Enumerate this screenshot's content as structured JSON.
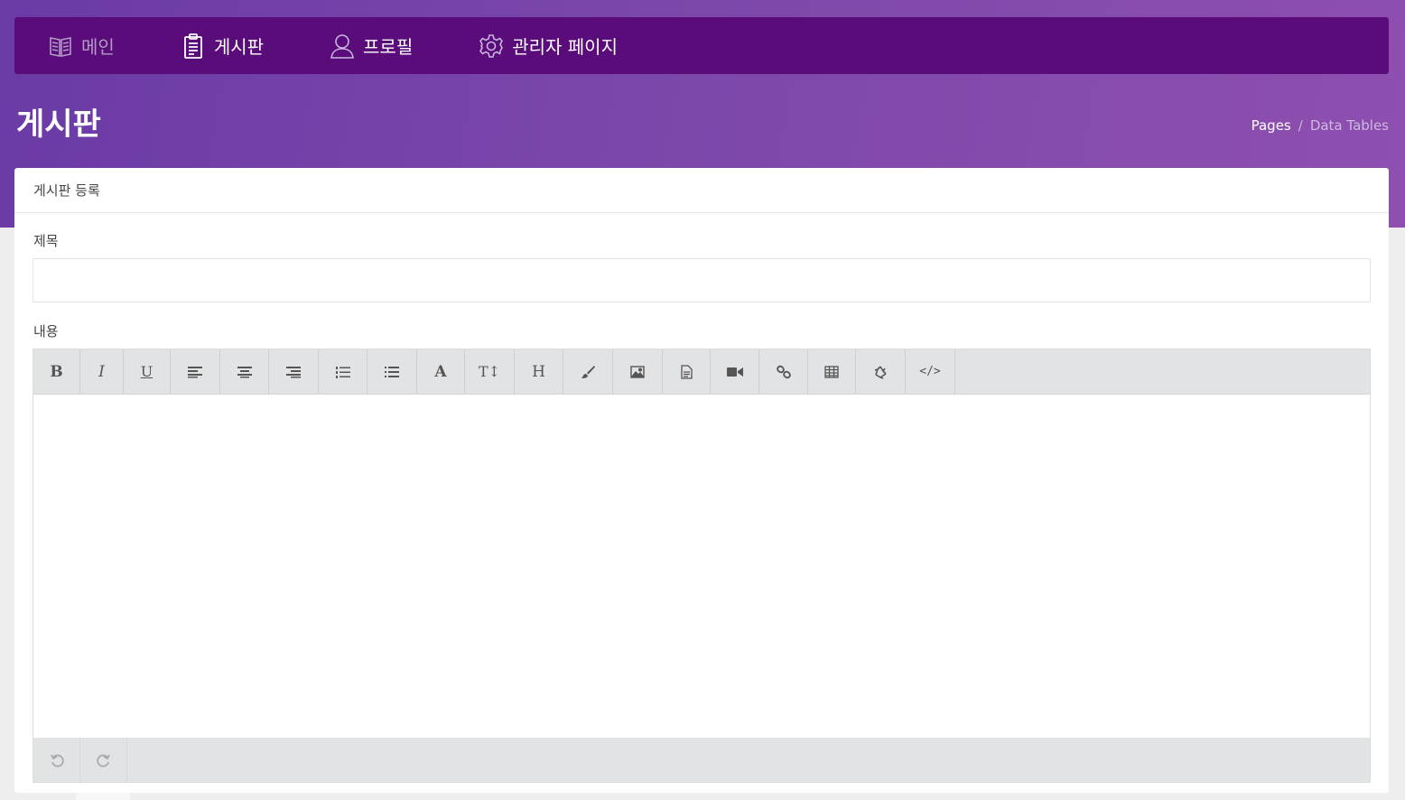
{
  "nav": {
    "items": [
      {
        "label": "메인",
        "icon": "book-icon"
      },
      {
        "label": "게시판",
        "icon": "clipboard-icon"
      },
      {
        "label": "프로필",
        "icon": "user-icon"
      },
      {
        "label": "관리자 페이지",
        "icon": "gear-icon"
      }
    ]
  },
  "header": {
    "title": "게시판",
    "breadcrumb": {
      "root": "Pages",
      "sep": "/",
      "current": "Data Tables"
    }
  },
  "card": {
    "title": "게시판 등록",
    "subject_label": "제목",
    "subject_value": "",
    "content_label": "내용"
  },
  "toolbar": {
    "buttons": [
      "bold",
      "italic",
      "underline",
      "align-left",
      "align-center",
      "align-right",
      "ordered-list",
      "unordered-list",
      "font-color",
      "font-size",
      "heading",
      "brush",
      "image",
      "file",
      "video",
      "link",
      "table",
      "recycle",
      "code"
    ],
    "bold": "B",
    "italic": "I",
    "underline": "U",
    "font": "A",
    "fontsize": "T↕",
    "heading": "H",
    "code": "</>"
  },
  "footer_tools": [
    "undo",
    "redo"
  ],
  "colors": {
    "accent": "#5a0c7a",
    "hero_start": "#6a3aa6",
    "hero_end": "#8e4fb0"
  }
}
